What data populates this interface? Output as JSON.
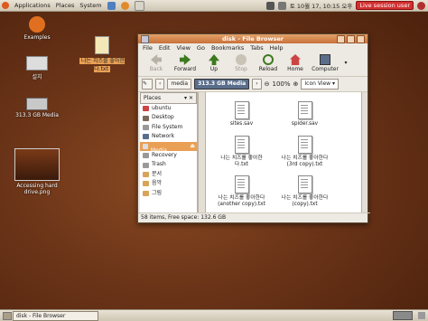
{
  "panel": {
    "menu_applications": "Applications",
    "menu_places": "Places",
    "menu_system": "System",
    "datetime": "토 10월 17, 10:15 오후",
    "user_button": "Live session user"
  },
  "desktop": {
    "icons": [
      {
        "label": "Examples"
      },
      {
        "label": "설치"
      },
      {
        "label": "313.3 GB Media"
      },
      {
        "label": "Accessing hard drive.png"
      },
      {
        "label": "나는 치즈를 좋아한다.txt"
      }
    ]
  },
  "window": {
    "title": "disk - File Browser",
    "menu": [
      "File",
      "Edit",
      "View",
      "Go",
      "Bookmarks",
      "Tabs",
      "Help"
    ],
    "toolbar": {
      "back": "Back",
      "forward": "Forward",
      "up": "Up",
      "stop": "Stop",
      "reload": "Reload",
      "home": "Home",
      "computer": "Computer"
    },
    "location": {
      "crumb_media": "media",
      "crumb_current": "313.3 GB Media",
      "zoom": "100%",
      "view_mode": "Icon View"
    },
    "sidebar": {
      "header": "Places",
      "items": [
        "ubuntu",
        "Desktop",
        "File System",
        "Network",
        "313.3 GB Media",
        "Recovery",
        "Trash",
        "문서",
        "음악",
        "그림"
      ]
    },
    "files": [
      {
        "name": "sites.sav"
      },
      {
        "name": "spider.sav"
      },
      {
        "name": "나는 치즈를 좋아한다.txt"
      },
      {
        "name": "나는 치즈를 좋아한다 (3rd copy).txt"
      },
      {
        "name": "나는 치즈를 좋아한다 (another copy).txt"
      },
      {
        "name": "나는 치즈를 좋아한다 (copy).txt"
      }
    ],
    "status": "58 items, Free space: 132.6 GB"
  },
  "taskbar": {
    "item": "disk - File Browser"
  },
  "colors": {
    "titlebar": "#c9713a",
    "selection": "#e9a055",
    "desktop": "#6b3418"
  }
}
